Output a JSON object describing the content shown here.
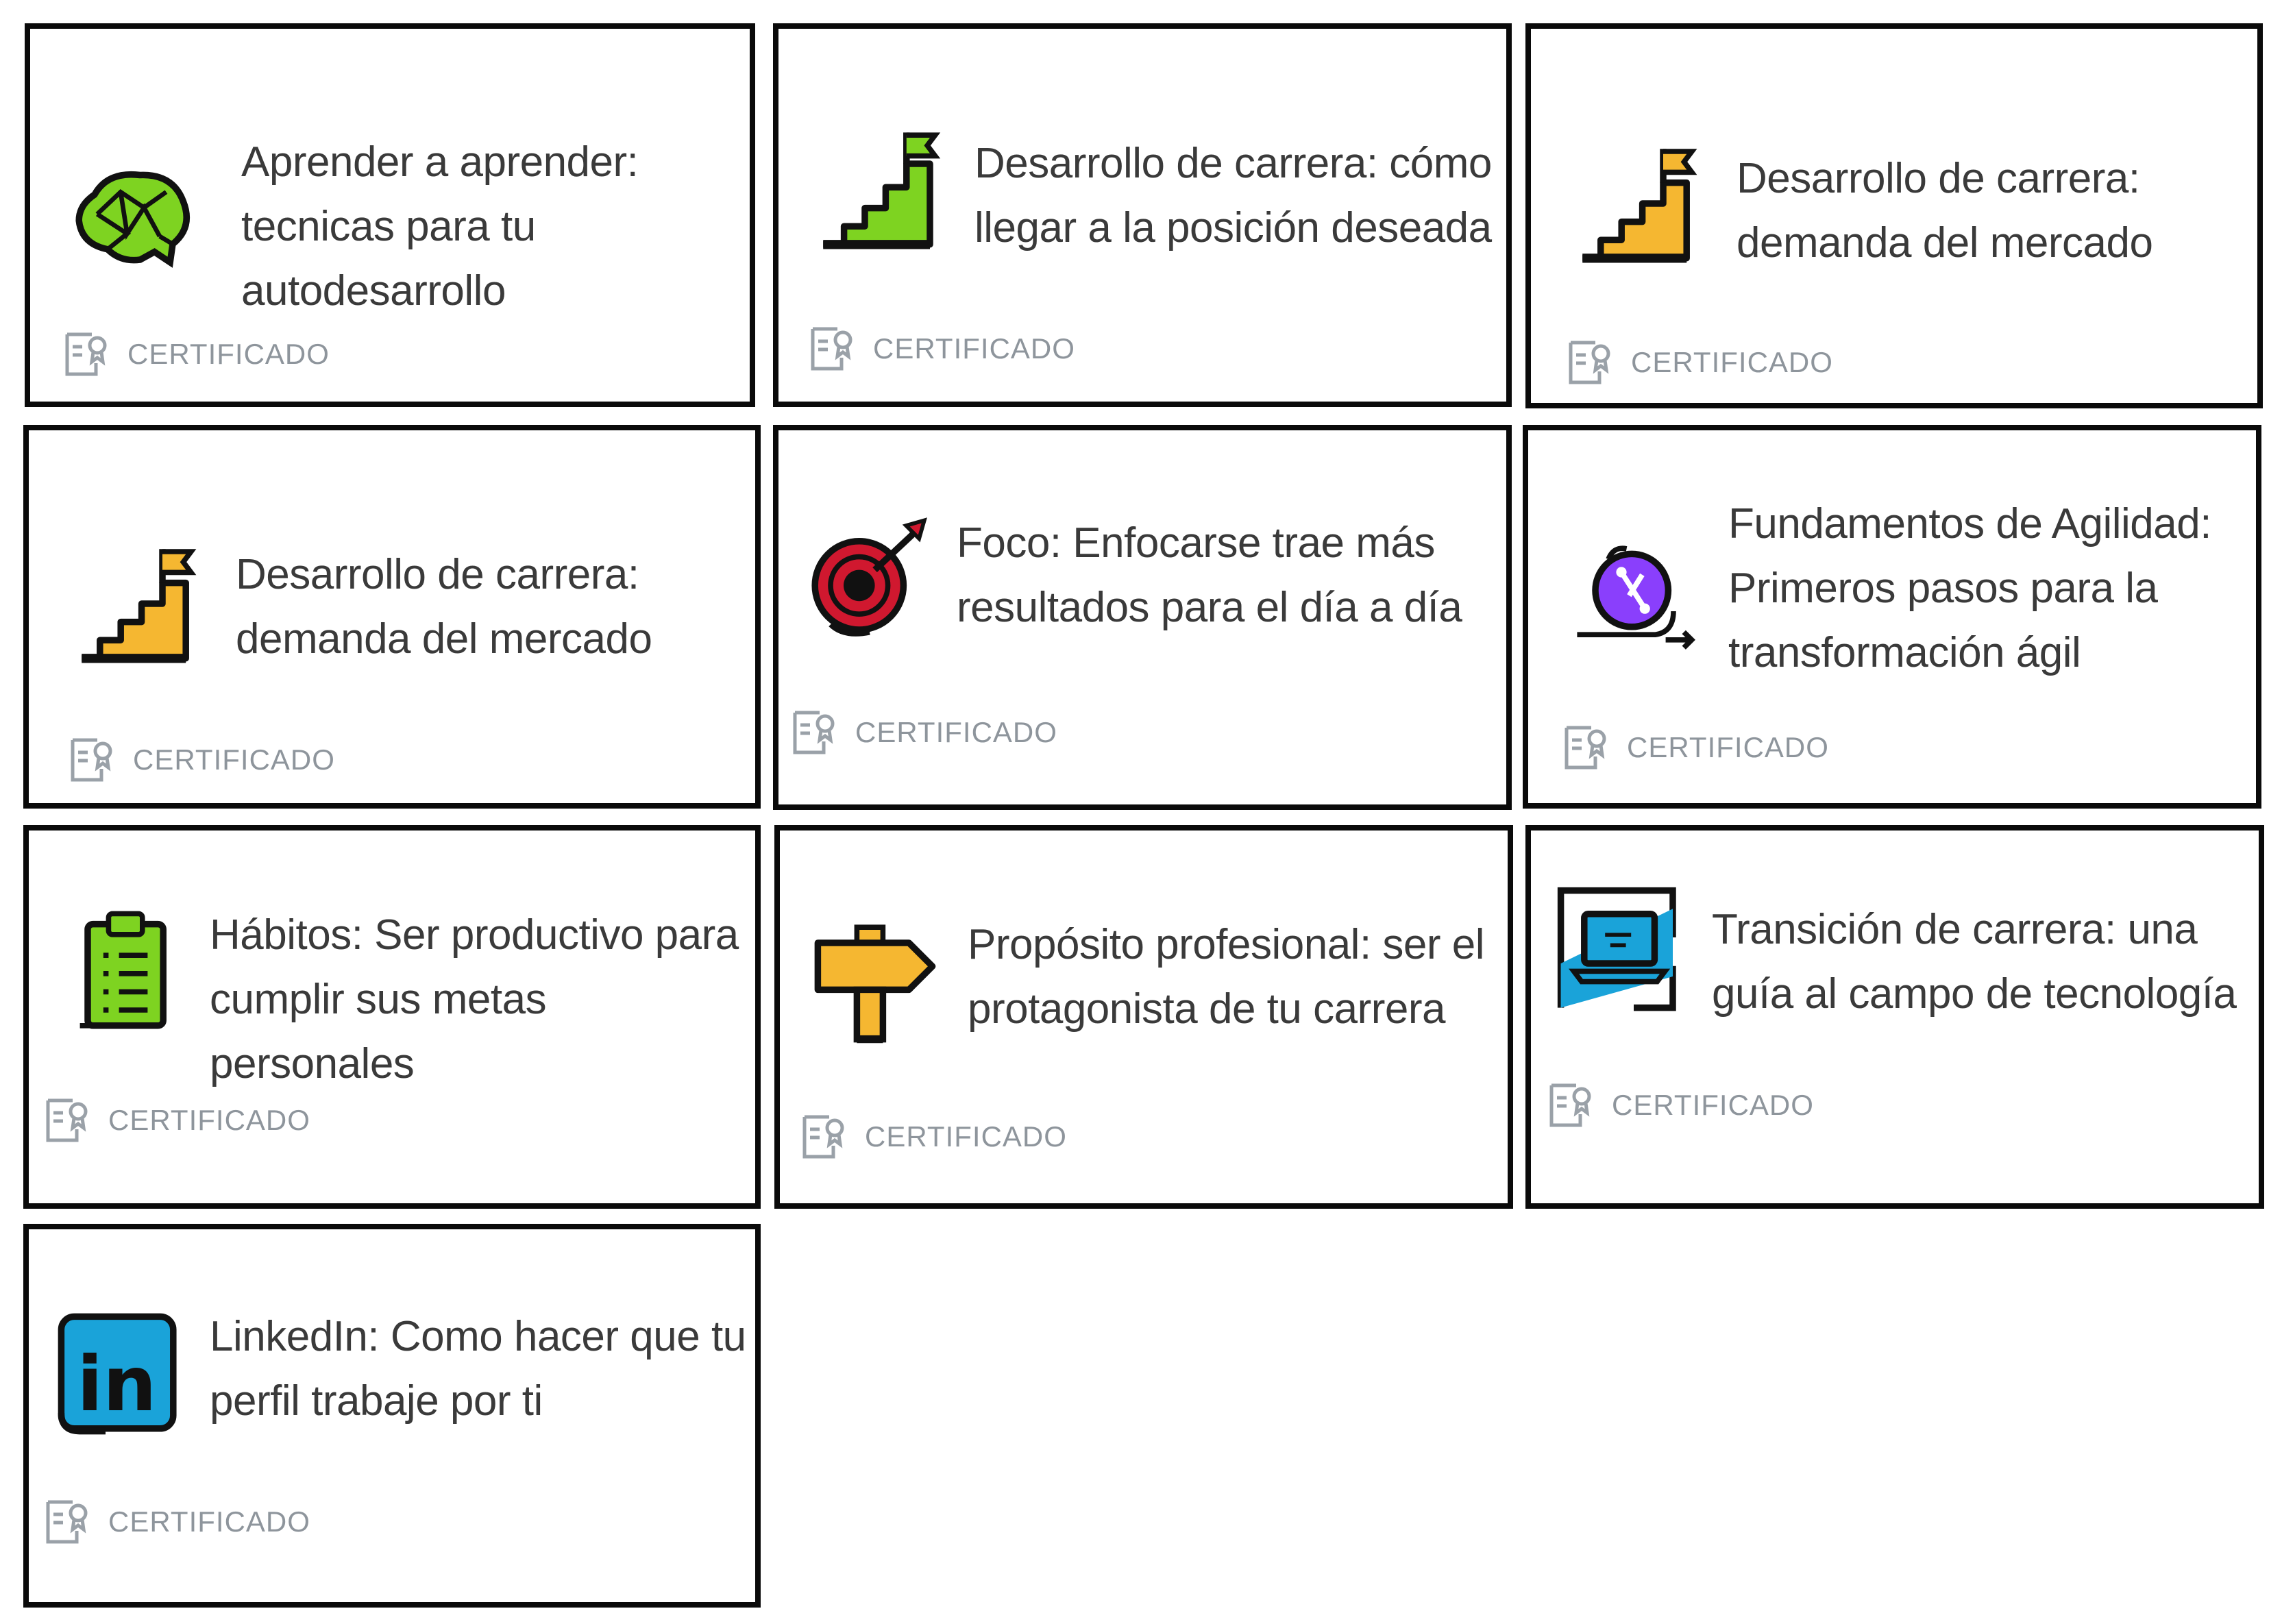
{
  "courses": [
    {
      "title": "Aprender a aprender:\ntecnicas para tu\nautodesarrollo",
      "label": "CERTIFICADO",
      "icon": "brain-icon"
    },
    {
      "title": "Desarrollo de carrera: cómo\nllegar a la posición deseada",
      "label": "CERTIFICADO",
      "icon": "career-stairs-green-icon"
    },
    {
      "title": "Desarrollo de carrera:\ndemanda del mercado",
      "label": "CERTIFICADO",
      "icon": "career-stairs-yellow-icon"
    },
    {
      "title": "Desarrollo de carrera:\ndemanda del mercado",
      "label": "CERTIFICADO",
      "icon": "career-stairs-yellow-icon"
    },
    {
      "title": "Foco: Enfocarse trae más\nresultados para el día a día",
      "label": "CERTIFICADO",
      "icon": "target-icon"
    },
    {
      "title": "Fundamentos de Agilidad:\nPrimeros pasos para la\ntransformación ágil",
      "label": "CERTIFICADO",
      "icon": "agility-icon"
    },
    {
      "title": "Hábitos: Ser productivo para\ncumplir sus metas personales",
      "label": "CERTIFICADO",
      "icon": "clipboard-icon"
    },
    {
      "title": "Propósito profesional: ser el\nprotagonista de tu carrera",
      "label": "CERTIFICADO",
      "icon": "signpost-icon"
    },
    {
      "title": "Transición de carrera: una\nguía al campo de tecnología",
      "label": "CERTIFICADO",
      "icon": "laptop-icon"
    },
    {
      "title": "LinkedIn: Como hacer que tu\nperfil trabaje por ti",
      "label": "CERTIFICADO",
      "icon": "linkedin-icon"
    }
  ],
  "colors": {
    "border": "#0a0a0a",
    "title": "#3a3a3a",
    "certificate_label": "#8e959c",
    "accent_green": "#7ed321",
    "accent_yellow": "#f5b731",
    "accent_red": "#d0182f",
    "accent_purple": "#8a3ffc",
    "accent_blue": "#1aa3d9"
  }
}
